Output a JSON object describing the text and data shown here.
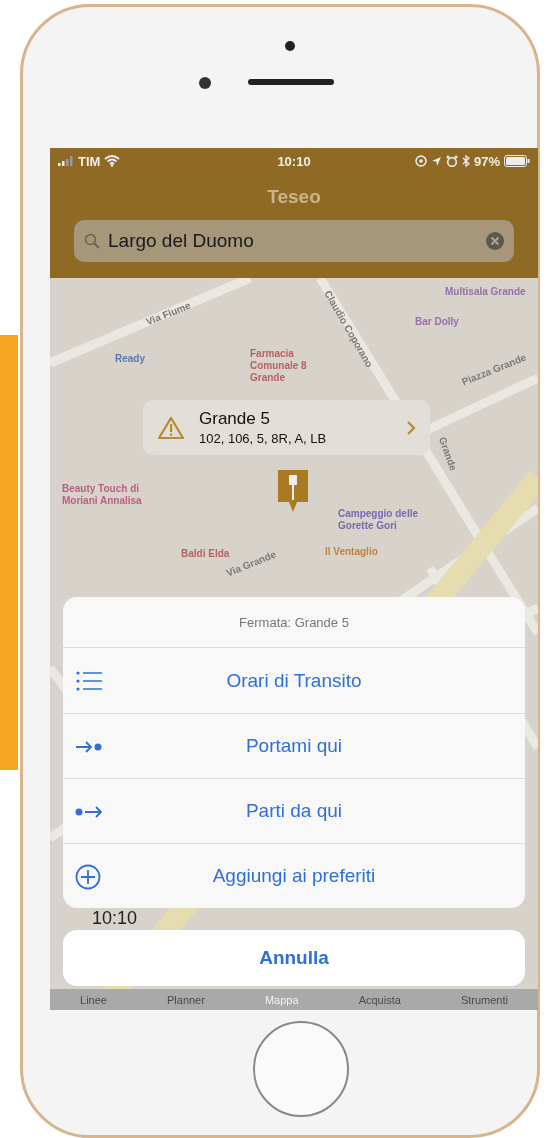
{
  "status_bar": {
    "carrier": "TIM",
    "time": "10:10",
    "battery": "97%"
  },
  "header": {
    "title": "Teseo"
  },
  "search": {
    "value": "Largo del Duomo"
  },
  "map": {
    "labels": [
      {
        "text": "Via Fiume",
        "kind": "street"
      },
      {
        "text": "Claudio Coporano",
        "kind": "street"
      },
      {
        "text": "Multisala Grande",
        "kind": "poi",
        "color": "#9a6fa8"
      },
      {
        "text": "Bar Dolly",
        "kind": "poi",
        "color": "#9a6fa8"
      },
      {
        "text": "Ready",
        "kind": "poi",
        "color": "#5a78b8"
      },
      {
        "text": "Farmacia Comunale 8 Grande",
        "kind": "poi",
        "color": "#b86060"
      },
      {
        "text": "Piazza Grande",
        "kind": "street"
      },
      {
        "text": "Grande",
        "kind": "street"
      },
      {
        "text": "Beauty Touch di Moriani Annalisa",
        "kind": "poi",
        "color": "#b86080"
      },
      {
        "text": "Campeggio delle Gorette Gori",
        "kind": "poi",
        "color": "#7868b0"
      },
      {
        "text": "Baldi Elda",
        "kind": "poi",
        "color": "#b86060"
      },
      {
        "text": "Il Ventaglio",
        "kind": "poi",
        "color": "#c08040"
      },
      {
        "text": "Via Grande",
        "kind": "street"
      }
    ]
  },
  "callout": {
    "title": "Grande 5",
    "lines": "102, 106, 5, 8R, A, LB"
  },
  "behind_sheet": {
    "time": "10:10"
  },
  "tabs": [
    {
      "label": "Linee",
      "selected": false
    },
    {
      "label": "Planner",
      "selected": false
    },
    {
      "label": "Mappa",
      "selected": true
    },
    {
      "label": "Acquista",
      "selected": false
    },
    {
      "label": "Strumenti",
      "selected": false
    }
  ],
  "action_sheet": {
    "title": "Fermata: Grande 5",
    "actions": [
      {
        "label": "Orari di Transito",
        "kind": "list"
      },
      {
        "label": "Portami qui",
        "kind": "to"
      },
      {
        "label": "Parti da qui",
        "kind": "from"
      },
      {
        "label": "Aggiungi ai preferiti",
        "kind": "add"
      }
    ],
    "cancel": "Annulla"
  }
}
